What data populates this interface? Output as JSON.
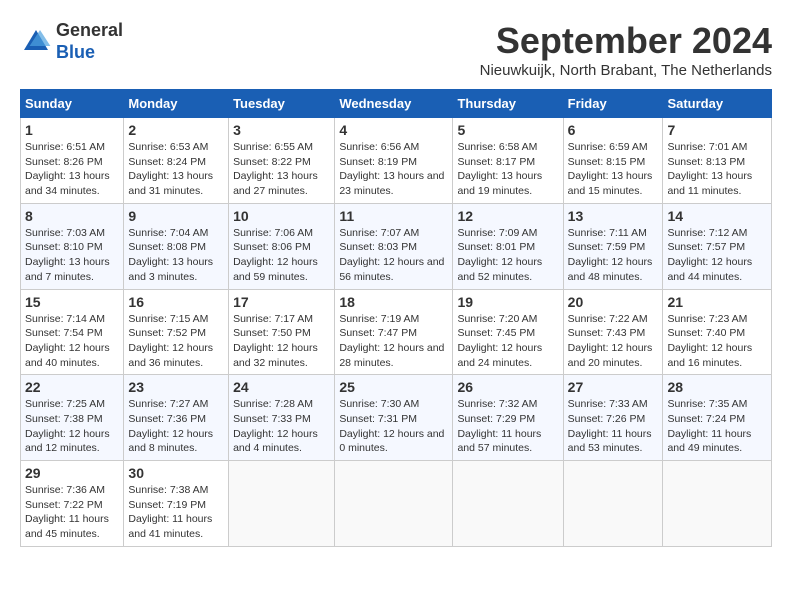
{
  "header": {
    "logo_line1": "General",
    "logo_line2": "Blue",
    "month": "September 2024",
    "location": "Nieuwkuijk, North Brabant, The Netherlands"
  },
  "weekdays": [
    "Sunday",
    "Monday",
    "Tuesday",
    "Wednesday",
    "Thursday",
    "Friday",
    "Saturday"
  ],
  "weeks": [
    [
      {
        "day": "1",
        "sunrise": "6:51 AM",
        "sunset": "8:26 PM",
        "daylight": "13 hours and 34 minutes."
      },
      {
        "day": "2",
        "sunrise": "6:53 AM",
        "sunset": "8:24 PM",
        "daylight": "13 hours and 31 minutes."
      },
      {
        "day": "3",
        "sunrise": "6:55 AM",
        "sunset": "8:22 PM",
        "daylight": "13 hours and 27 minutes."
      },
      {
        "day": "4",
        "sunrise": "6:56 AM",
        "sunset": "8:19 PM",
        "daylight": "13 hours and 23 minutes."
      },
      {
        "day": "5",
        "sunrise": "6:58 AM",
        "sunset": "8:17 PM",
        "daylight": "13 hours and 19 minutes."
      },
      {
        "day": "6",
        "sunrise": "6:59 AM",
        "sunset": "8:15 PM",
        "daylight": "13 hours and 15 minutes."
      },
      {
        "day": "7",
        "sunrise": "7:01 AM",
        "sunset": "8:13 PM",
        "daylight": "13 hours and 11 minutes."
      }
    ],
    [
      {
        "day": "8",
        "sunrise": "7:03 AM",
        "sunset": "8:10 PM",
        "daylight": "13 hours and 7 minutes."
      },
      {
        "day": "9",
        "sunrise": "7:04 AM",
        "sunset": "8:08 PM",
        "daylight": "13 hours and 3 minutes."
      },
      {
        "day": "10",
        "sunrise": "7:06 AM",
        "sunset": "8:06 PM",
        "daylight": "12 hours and 59 minutes."
      },
      {
        "day": "11",
        "sunrise": "7:07 AM",
        "sunset": "8:03 PM",
        "daylight": "12 hours and 56 minutes."
      },
      {
        "day": "12",
        "sunrise": "7:09 AM",
        "sunset": "8:01 PM",
        "daylight": "12 hours and 52 minutes."
      },
      {
        "day": "13",
        "sunrise": "7:11 AM",
        "sunset": "7:59 PM",
        "daylight": "12 hours and 48 minutes."
      },
      {
        "day": "14",
        "sunrise": "7:12 AM",
        "sunset": "7:57 PM",
        "daylight": "12 hours and 44 minutes."
      }
    ],
    [
      {
        "day": "15",
        "sunrise": "7:14 AM",
        "sunset": "7:54 PM",
        "daylight": "12 hours and 40 minutes."
      },
      {
        "day": "16",
        "sunrise": "7:15 AM",
        "sunset": "7:52 PM",
        "daylight": "12 hours and 36 minutes."
      },
      {
        "day": "17",
        "sunrise": "7:17 AM",
        "sunset": "7:50 PM",
        "daylight": "12 hours and 32 minutes."
      },
      {
        "day": "18",
        "sunrise": "7:19 AM",
        "sunset": "7:47 PM",
        "daylight": "12 hours and 28 minutes."
      },
      {
        "day": "19",
        "sunrise": "7:20 AM",
        "sunset": "7:45 PM",
        "daylight": "12 hours and 24 minutes."
      },
      {
        "day": "20",
        "sunrise": "7:22 AM",
        "sunset": "7:43 PM",
        "daylight": "12 hours and 20 minutes."
      },
      {
        "day": "21",
        "sunrise": "7:23 AM",
        "sunset": "7:40 PM",
        "daylight": "12 hours and 16 minutes."
      }
    ],
    [
      {
        "day": "22",
        "sunrise": "7:25 AM",
        "sunset": "7:38 PM",
        "daylight": "12 hours and 12 minutes."
      },
      {
        "day": "23",
        "sunrise": "7:27 AM",
        "sunset": "7:36 PM",
        "daylight": "12 hours and 8 minutes."
      },
      {
        "day": "24",
        "sunrise": "7:28 AM",
        "sunset": "7:33 PM",
        "daylight": "12 hours and 4 minutes."
      },
      {
        "day": "25",
        "sunrise": "7:30 AM",
        "sunset": "7:31 PM",
        "daylight": "12 hours and 0 minutes."
      },
      {
        "day": "26",
        "sunrise": "7:32 AM",
        "sunset": "7:29 PM",
        "daylight": "11 hours and 57 minutes."
      },
      {
        "day": "27",
        "sunrise": "7:33 AM",
        "sunset": "7:26 PM",
        "daylight": "11 hours and 53 minutes."
      },
      {
        "day": "28",
        "sunrise": "7:35 AM",
        "sunset": "7:24 PM",
        "daylight": "11 hours and 49 minutes."
      }
    ],
    [
      {
        "day": "29",
        "sunrise": "7:36 AM",
        "sunset": "7:22 PM",
        "daylight": "11 hours and 45 minutes."
      },
      {
        "day": "30",
        "sunrise": "7:38 AM",
        "sunset": "7:19 PM",
        "daylight": "11 hours and 41 minutes."
      },
      null,
      null,
      null,
      null,
      null
    ]
  ]
}
